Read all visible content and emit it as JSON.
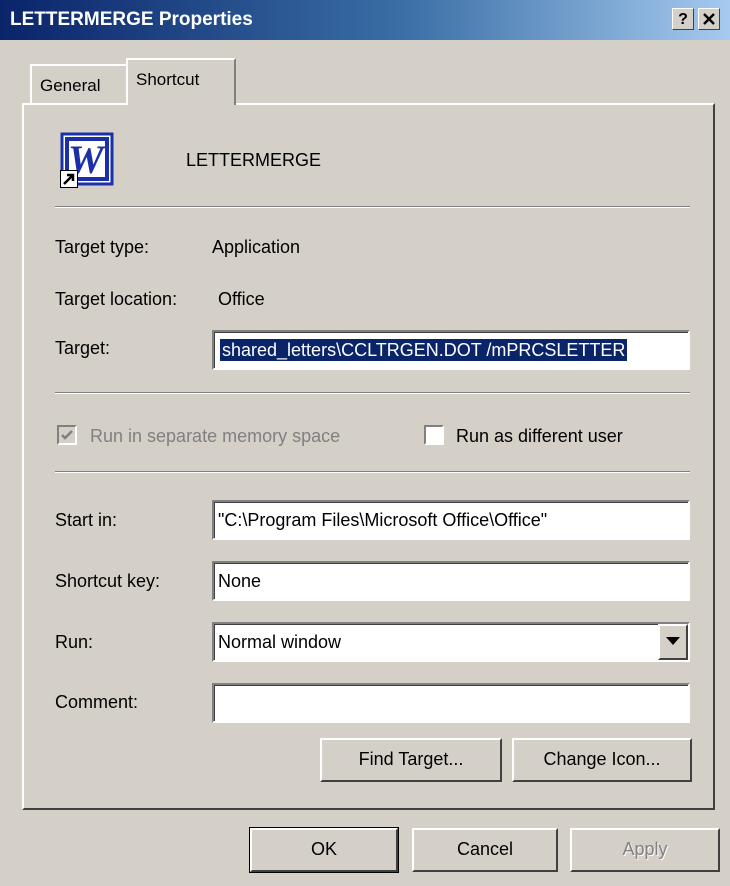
{
  "window": {
    "title": "LETTERMERGE Properties",
    "help_label": "?",
    "close_label": "✕"
  },
  "tabs": [
    {
      "label": "General",
      "selected": false
    },
    {
      "label": "Shortcut",
      "selected": true
    }
  ],
  "shortcut": {
    "name": "LETTERMERGE",
    "app_icon_letter": "W",
    "target_type_label": "Target type:",
    "target_type_value": "Application",
    "target_location_label": "Target location:",
    "target_location_value": "Office",
    "target_label": "Target:",
    "target_value": "shared_letters\\CCLTRGEN.DOT /mPRCSLETTER",
    "run_separate_label": "Run in separate memory space",
    "run_separate_checked": true,
    "run_as_user_label": "Run as different user",
    "run_as_user_checked": false,
    "start_in_label": "Start in:",
    "start_in_value": "\"C:\\Program Files\\Microsoft Office\\Office\"",
    "shortcut_key_label": "Shortcut key:",
    "shortcut_key_value": "None",
    "run_label": "Run:",
    "run_value": "Normal window",
    "comment_label": "Comment:",
    "comment_value": "",
    "find_target_label": "Find Target...",
    "change_icon_label": "Change Icon..."
  },
  "footer": {
    "ok_label": "OK",
    "cancel_label": "Cancel",
    "apply_label": "Apply"
  },
  "colors": {
    "titlebar": "#0a246a",
    "face": "#d4d0c8",
    "selection": "#0a246a",
    "word_blue": "#1a2fa8"
  }
}
